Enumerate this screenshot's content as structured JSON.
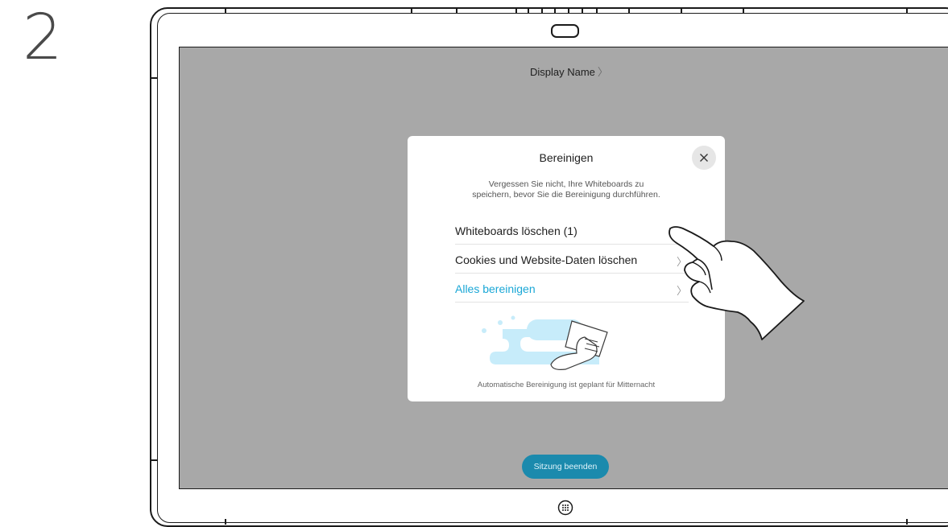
{
  "step": {
    "number": "2"
  },
  "header": {
    "display_name": "Display Name",
    "chevron": "〉"
  },
  "dialog": {
    "title": "Bereinigen",
    "close_icon": "close-icon",
    "description": "Vergessen Sie nicht, Ihre Whiteboards zu speichern, bevor Sie die Bereinigung durchführen.",
    "items": [
      {
        "label": "Whiteboards löschen (1)",
        "has_chevron": false
      },
      {
        "label": "Cookies und Website-Daten löschen",
        "has_chevron": true,
        "chevron": "〉"
      },
      {
        "label": "Alles bereinigen",
        "has_chevron": true,
        "chevron": "〉",
        "accent": true
      }
    ],
    "footer": "Automatische Bereinigung ist geplant für Mitternacht"
  },
  "end_session": {
    "label": "Sitzung beenden"
  },
  "colors": {
    "screen": "#a8a8a8",
    "accent": "#1aa7d6",
    "button": "#1b8aad",
    "illustration": "#c7ecfa"
  },
  "icons": [
    "close-icon",
    "chevron-right-icon",
    "home-grid-icon",
    "camera-icon",
    "hand-pointer-icon",
    "wipe-illustration"
  ]
}
